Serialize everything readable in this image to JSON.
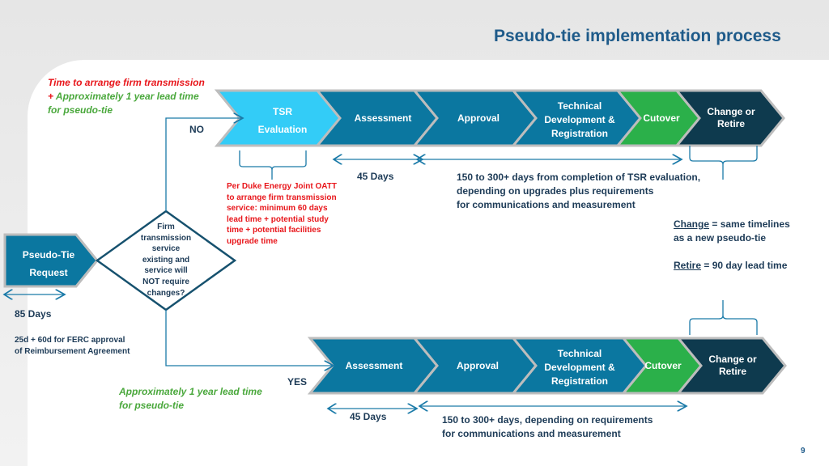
{
  "title": "Pseudo-tie implementation process",
  "page_number": "9",
  "colors": {
    "light_blue": "#33ccf7",
    "teal": "#0b77a0",
    "green": "#2bb04a",
    "dark": "#0e3a4e",
    "red": "#e8161b",
    "green_text": "#4aa83c",
    "title": "#1f5b8a"
  },
  "top_note": {
    "line1": "Time to arrange firm transmission",
    "plus": "+",
    "line2": " Approximately 1 year lead time",
    "line3": "for pseudo-tie"
  },
  "no_label": "NO",
  "yes_label": "YES",
  "request": {
    "line1": "Pseudo-Tie",
    "line2": "Request"
  },
  "decision": [
    "Firm",
    "transmission",
    "service",
    "existing and",
    "service will",
    "NOT require",
    "changes?"
  ],
  "top_row": {
    "tsr": [
      "TSR",
      "Evaluation"
    ],
    "assessment": "Assessment",
    "approval": "Approval",
    "technical": [
      "Technical",
      "Development &",
      "Registration"
    ],
    "cutover": "Cutover",
    "change": [
      "Change or",
      "Retire"
    ]
  },
  "bottom_row": {
    "assessment": "Assessment",
    "approval": "Approval",
    "technical": [
      "Technical",
      "Development &",
      "Registration"
    ],
    "cutover": "Cutover",
    "change": [
      "Change or",
      "Retire"
    ]
  },
  "oatt_note": [
    "Per Duke Energy Joint OATT",
    "to arrange firm transmission",
    "service: minimum 60 days",
    "lead time + potential study",
    "time + potential facilities",
    "upgrade time"
  ],
  "top_45": "45 Days",
  "top_150": [
    "150 to 300+ days from completion of TSR evaluation,",
    "depending on upgrades plus requirements",
    "for communications and measurement"
  ],
  "change_note": {
    "change": "Change",
    "change_rest": " = same timelines",
    "change_line2": "as a new pseudo-tie",
    "retire": "Retire",
    "retire_rest": " = 90 day lead time"
  },
  "days85": "85 Days",
  "ferc": [
    "25d + 60d  for FERC approval",
    "of Reimbursement Agreement"
  ],
  "bottom_note": [
    "Approximately 1 year lead time",
    "for pseudo-tie"
  ],
  "bottom_45": "45 Days",
  "bottom_150": [
    "150 to 300+ days, depending on requirements",
    "for communications and measurement"
  ]
}
